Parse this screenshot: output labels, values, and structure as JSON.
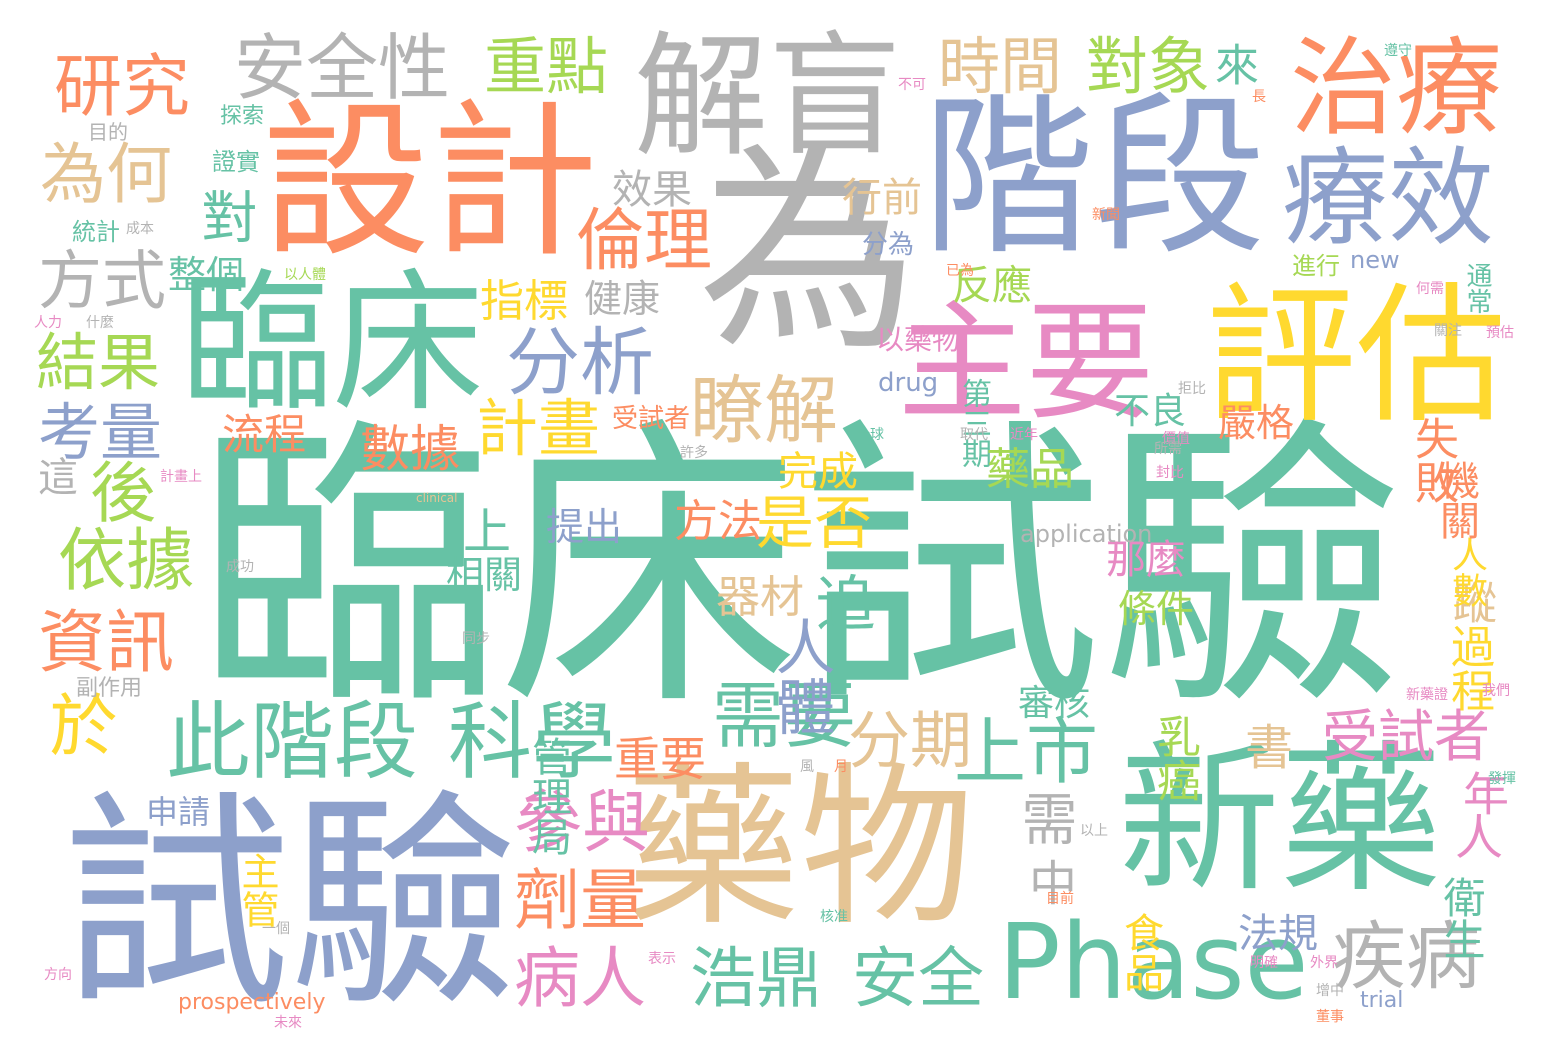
{
  "palette": {
    "green": "#66c2a5",
    "orange": "#fc8d62",
    "blue": "#8da0cb",
    "pink": "#e78ac3",
    "lime": "#a6d854",
    "yellow": "#ffd92f",
    "tan": "#e5c494",
    "gray": "#b3b3b3"
  },
  "words": [
    {
      "text": "臨床試驗",
      "color": "green"
    },
    {
      "text": "試驗",
      "color": "blue"
    },
    {
      "text": "藥物",
      "color": "tan"
    },
    {
      "text": "新藥",
      "color": "green"
    },
    {
      "text": "為",
      "color": "gray"
    },
    {
      "text": "階段",
      "color": "blue"
    },
    {
      "text": "設計",
      "color": "orange"
    },
    {
      "text": "臨床",
      "color": "green"
    },
    {
      "text": "解盲",
      "color": "gray"
    },
    {
      "text": "主要",
      "color": "pink"
    },
    {
      "text": "評估",
      "color": "yellow"
    },
    {
      "text": "Phase",
      "color": "green"
    },
    {
      "text": "治療",
      "color": "orange"
    },
    {
      "text": "療效",
      "color": "blue"
    },
    {
      "text": "此階段",
      "color": "green"
    },
    {
      "text": "科學",
      "color": "green"
    },
    {
      "text": "安全性",
      "color": "gray"
    },
    {
      "text": "研究",
      "color": "orange"
    },
    {
      "text": "重點",
      "color": "lime"
    },
    {
      "text": "時間",
      "color": "tan"
    },
    {
      "text": "對象",
      "color": "lime"
    },
    {
      "text": "為何",
      "color": "tan"
    },
    {
      "text": "方式",
      "color": "gray"
    },
    {
      "text": "結果",
      "color": "lime"
    },
    {
      "text": "考量",
      "color": "blue"
    },
    {
      "text": "分析",
      "color": "blue"
    },
    {
      "text": "瞭解",
      "color": "tan"
    },
    {
      "text": "倫理",
      "color": "orange"
    },
    {
      "text": "需要",
      "color": "green"
    },
    {
      "text": "上市",
      "color": "green"
    },
    {
      "text": "參與",
      "color": "pink"
    },
    {
      "text": "劑量",
      "color": "orange"
    },
    {
      "text": "病人",
      "color": "pink"
    },
    {
      "text": "浩鼎",
      "color": "green"
    },
    {
      "text": "安全",
      "color": "green"
    },
    {
      "text": "疾病",
      "color": "gray"
    },
    {
      "text": "受試者",
      "color": "pink"
    },
    {
      "text": "分期",
      "color": "tan"
    },
    {
      "text": "計畫",
      "color": "yellow"
    },
    {
      "text": "是否",
      "color": "yellow"
    },
    {
      "text": "資訊",
      "color": "orange"
    },
    {
      "text": "依據",
      "color": "lime"
    },
    {
      "text": "數據",
      "color": "orange"
    },
    {
      "text": "人體",
      "color": "blue"
    },
    {
      "text": "重要",
      "color": "orange"
    },
    {
      "text": "方法",
      "color": "orange"
    },
    {
      "text": "藥品",
      "color": "lime"
    },
    {
      "text": "完成",
      "color": "yellow"
    },
    {
      "text": "失敗",
      "color": "orange"
    },
    {
      "text": "乳癌",
      "color": "lime"
    },
    {
      "text": "指標",
      "color": "yellow"
    },
    {
      "text": "流程",
      "color": "orange"
    },
    {
      "text": "反應",
      "color": "lime"
    },
    {
      "text": "效果",
      "color": "gray"
    },
    {
      "text": "行前",
      "color": "tan"
    },
    {
      "text": "器材",
      "color": "tan"
    },
    {
      "text": "整個",
      "color": "green"
    },
    {
      "text": "提出",
      "color": "blue"
    },
    {
      "text": "健康",
      "color": "gray"
    },
    {
      "text": "不良",
      "color": "green"
    },
    {
      "text": "嚴格",
      "color": "orange"
    },
    {
      "text": "那麼",
      "color": "pink"
    },
    {
      "text": "相關",
      "color": "green"
    },
    {
      "text": "條件",
      "color": "lime"
    },
    {
      "text": "審核",
      "color": "green"
    },
    {
      "text": "食品",
      "color": "yellow"
    },
    {
      "text": "法規",
      "color": "blue"
    },
    {
      "text": "衛生",
      "color": "green"
    },
    {
      "text": "過程",
      "color": "yellow"
    },
    {
      "text": "機關",
      "color": "orange"
    },
    {
      "text": "管理局",
      "color": "green"
    },
    {
      "text": "主管",
      "color": "yellow"
    },
    {
      "text": "申請",
      "color": "blue"
    },
    {
      "text": "副作用",
      "color": "gray"
    },
    {
      "text": "統計",
      "color": "green"
    },
    {
      "text": "證實",
      "color": "green"
    },
    {
      "text": "探索",
      "color": "green"
    },
    {
      "text": "目的",
      "color": "gray"
    },
    {
      "text": "分為",
      "color": "blue"
    },
    {
      "text": "進行",
      "color": "lime"
    },
    {
      "text": "通常",
      "color": "green"
    },
    {
      "text": "第三期",
      "color": "green"
    },
    {
      "text": "以藥物",
      "color": "pink"
    },
    {
      "text": "drug",
      "color": "blue"
    },
    {
      "text": "new",
      "color": "blue"
    },
    {
      "text": "受試者",
      "color": "orange"
    },
    {
      "text": "最",
      "color": "blue"
    },
    {
      "text": "中",
      "color": "gray"
    },
    {
      "text": "需",
      "color": "gray"
    },
    {
      "text": "書",
      "color": "tan"
    },
    {
      "text": "人",
      "color": "pink"
    },
    {
      "text": "年",
      "color": "pink"
    },
    {
      "text": "於",
      "color": "yellow"
    },
    {
      "text": "後",
      "color": "lime"
    },
    {
      "text": "對",
      "color": "green"
    },
    {
      "text": "來",
      "color": "green"
    },
    {
      "text": "上",
      "color": "green"
    },
    {
      "text": "追",
      "color": "green"
    },
    {
      "text": "這",
      "color": "gray"
    },
    {
      "text": "蹤",
      "color": "tan"
    },
    {
      "text": "人數",
      "color": "yellow"
    },
    {
      "text": "application",
      "color": "gray"
    },
    {
      "text": "trial",
      "color": "blue"
    },
    {
      "text": "prospectively",
      "color": "orange"
    },
    {
      "text": "clinical",
      "color": "tan"
    },
    {
      "text": "成功",
      "color": "gray"
    },
    {
      "text": "取代",
      "color": "gray"
    },
    {
      "text": "近年",
      "color": "pink"
    },
    {
      "text": "全球",
      "color": "green"
    },
    {
      "text": "許多",
      "color": "gray"
    },
    {
      "text": "計畫上",
      "color": "pink"
    },
    {
      "text": "以人體",
      "color": "lime"
    },
    {
      "text": "成本",
      "color": "gray"
    },
    {
      "text": "核准",
      "color": "green"
    },
    {
      "text": "目前",
      "color": "orange"
    },
    {
      "text": "以上",
      "color": "gray"
    },
    {
      "text": "新藥證",
      "color": "pink"
    },
    {
      "text": "未來",
      "color": "pink"
    },
    {
      "text": "外界",
      "color": "pink"
    },
    {
      "text": "董事",
      "color": "orange"
    },
    {
      "text": "增中",
      "color": "gray"
    },
    {
      "text": "一個",
      "color": "gray"
    },
    {
      "text": "風",
      "color": "gray"
    },
    {
      "text": "月",
      "color": "orange"
    },
    {
      "text": "方向",
      "color": "pink"
    },
    {
      "text": "表示",
      "color": "pink"
    },
    {
      "text": "人力",
      "color": "pink"
    },
    {
      "text": "什麼",
      "color": "gray"
    },
    {
      "text": "長",
      "color": "orange"
    },
    {
      "text": "遵守",
      "color": "green"
    },
    {
      "text": "不可",
      "color": "pink"
    },
    {
      "text": "關注",
      "color": "gray"
    },
    {
      "text": "預估",
      "color": "pink"
    },
    {
      "text": "拒比",
      "color": "gray"
    },
    {
      "text": "何需",
      "color": "pink"
    },
    {
      "text": "已為",
      "color": "orange"
    },
    {
      "text": "新聞",
      "color": "orange"
    },
    {
      "text": "封比",
      "color": "pink"
    },
    {
      "text": "價值",
      "color": "pink"
    },
    {
      "text": "所需",
      "color": "gray"
    },
    {
      "text": "我們",
      "color": "pink"
    },
    {
      "text": "發揮",
      "color": "green"
    },
    {
      "text": "明確",
      "color": "pink"
    },
    {
      "text": "同步",
      "color": "gray"
    }
  ]
}
